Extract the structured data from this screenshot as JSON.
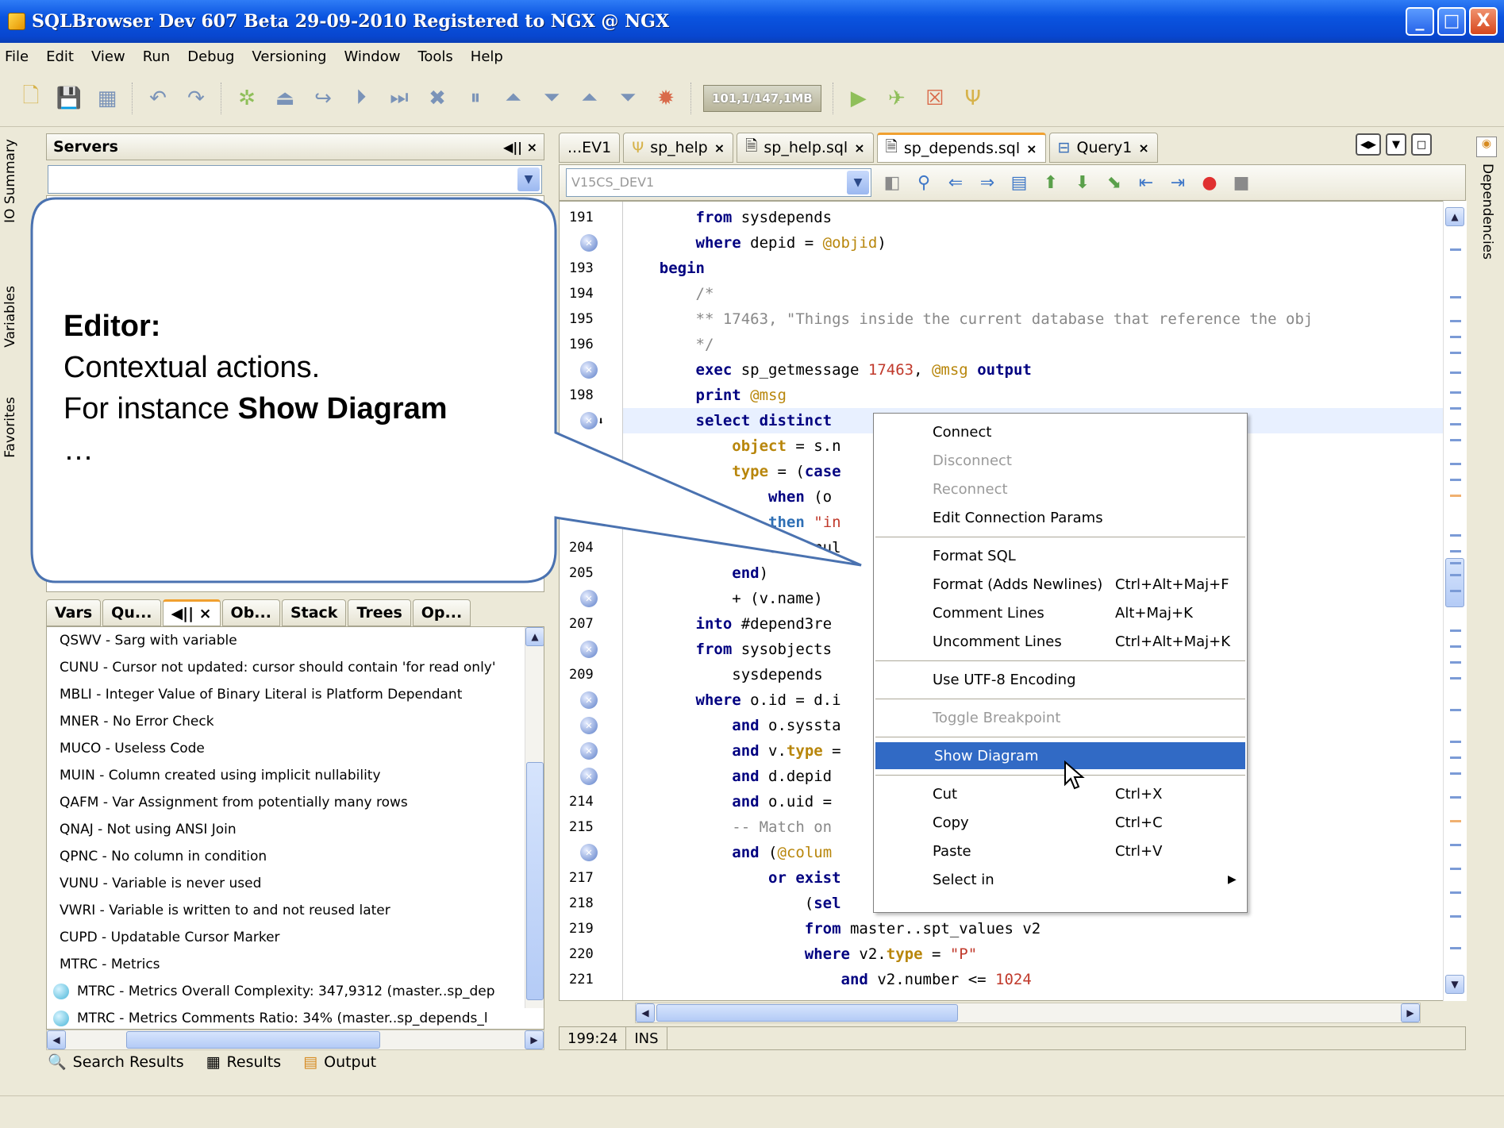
{
  "window": {
    "title": "SQLBrowser Dev 607 Beta  29-09-2010  Registered to NGX @ NGX",
    "minimize": "_",
    "maximize": "□",
    "close": "X"
  },
  "menu": [
    "File",
    "Edit",
    "View",
    "Run",
    "Debug",
    "Versioning",
    "Window",
    "Tools",
    "Help"
  ],
  "toolbar": {
    "memory": "101,1/147,1MB"
  },
  "left_side_tabs": [
    "IO Summary",
    "Variables",
    "Favorites"
  ],
  "servers_panel": {
    "title": "Servers",
    "controls": "◀|| ×"
  },
  "bottom_panel": {
    "tabs": [
      "Vars",
      "Qu...",
      "",
      "Ob...",
      "Stack",
      "Trees",
      "Op..."
    ],
    "active_controls": "◀|| ×",
    "rules": [
      "QSWV - Sarg with variable",
      "CUNU - Cursor not updated: cursor should contain 'for read only'",
      "MBLI - Integer Value of Binary Literal is Platform Dependant",
      "MNER - No Error Check",
      "MUCO - Useless Code",
      "MUIN - Column created using implicit nullability",
      "QAFM - Var Assignment from potentially many rows",
      "QNAJ - Not using ANSI Join",
      "QPNC - No column in condition",
      "VUNU - Variable is never used",
      "VWRI - Variable is written to and not reused later",
      "CUPD - Updatable Cursor Marker",
      "MTRC - Metrics"
    ],
    "metrics": [
      "MTRC - Metrics Overall Complexity: 347,9312 (master..sp_dep",
      "MTRC - Metrics Comments Ratio: 34% (master..sp_depends_l"
    ]
  },
  "bottom_status": [
    "Search Results",
    "Results",
    "Output"
  ],
  "editor": {
    "tabs": [
      {
        "label": "...EV1",
        "close": ""
      },
      {
        "label": "sp_help",
        "close": "×"
      },
      {
        "label": "sp_help.sql",
        "close": "×"
      },
      {
        "label": "sp_depends.sql",
        "close": "×"
      },
      {
        "label": "Query1",
        "close": "×"
      }
    ],
    "connection": "V15CS_DEV1",
    "cursor_pos": "199:24",
    "mode": "INS",
    "right_tab": "Dependencies"
  },
  "code_lines": [
    {
      "n": "191",
      "err": false,
      "html": "        <span class='kw'>from</span> sysdepends"
    },
    {
      "n": "",
      "err": true,
      "html": "        <span class='kw'>where</span> depid = <span class='var'>@objid</span>)"
    },
    {
      "n": "193",
      "err": false,
      "html": "    <span class='kw'>begin</span>"
    },
    {
      "n": "194",
      "err": false,
      "html": "        <span class='cm'>/*</span>"
    },
    {
      "n": "195",
      "err": false,
      "html": "        <span class='cm'>** 17463, \"Things inside the current database that reference the obj</span>"
    },
    {
      "n": "196",
      "err": false,
      "html": "        <span class='cm'>*/</span>"
    },
    {
      "n": "",
      "err": true,
      "html": "        <span class='kw'>exec</span> sp_getmessage <span class='num'>17463</span>, <span class='var'>@msg</span> <span class='kw'>output</span>"
    },
    {
      "n": "198",
      "err": false,
      "html": "        <span class='kw'>print</span> <span class='var'>@msg</span>"
    },
    {
      "n": "",
      "err": true,
      "html": "        <span class='kw'>select distinct</span>"
    },
    {
      "n": "",
      "err": false,
      "html": "            <span class='ty'>object</span> = s.n"
    },
    {
      "n": "",
      "err": false,
      "html": "            <span class='ty'>type</span> = (<span class='kw'>case</span>"
    },
    {
      "n": "",
      "err": false,
      "html": "                <span class='kw'>when</span> (o"
    },
    {
      "n": "",
      "err": false,
      "html": "                <span class='kw' style='color:#2e6fb5'>then</span> <span class='str'>\"in</span>"
    },
    {
      "n": "204",
      "err": false,
      "html": "                <span class='kw'>else</span> nul"
    },
    {
      "n": "205",
      "err": false,
      "html": "            <span class='kw'>end</span>)"
    },
    {
      "n": "",
      "err": true,
      "html": "            + (v.name)"
    },
    {
      "n": "207",
      "err": false,
      "html": "        <span class='kw'>into</span> #depend3re"
    },
    {
      "n": "",
      "err": true,
      "html": "        <span class='kw'>from</span> sysobjects"
    },
    {
      "n": "209",
      "err": false,
      "html": "            sysdepends"
    },
    {
      "n": "",
      "err": true,
      "html": "        <span class='kw'>where</span> o.id = d.i"
    },
    {
      "n": "",
      "err": true,
      "html": "            <span class='kw'>and</span> o.syssta"
    },
    {
      "n": "",
      "err": true,
      "html": "            <span class='kw'>and</span> v.<span class='ty'>type</span> ="
    },
    {
      "n": "",
      "err": true,
      "html": "            <span class='kw'>and</span> d.depid"
    },
    {
      "n": "214",
      "err": false,
      "html": "            <span class='kw'>and</span> o.uid ="
    },
    {
      "n": "215",
      "err": false,
      "html": "            <span class='cm'>-- Match on</span>"
    },
    {
      "n": "",
      "err": true,
      "html": "            <span class='kw'>and</span> (<span class='var'>@colum</span>"
    },
    {
      "n": "217",
      "err": false,
      "html": "                <span class='kw'>or exist</span>"
    },
    {
      "n": "218",
      "err": false,
      "html": "                    (<span class='kw'>sel</span>"
    },
    {
      "n": "219",
      "err": false,
      "html": "                    <span class='kw'>from</span> master..spt_values v2"
    },
    {
      "n": "220",
      "err": false,
      "html": "                    <span class='kw'>where</span> v2.<span class='ty'>type</span> = <span class='str'>\"P\"</span>"
    },
    {
      "n": "221",
      "err": false,
      "html": "                        <span class='kw'>and</span> v2.number &lt;= <span class='num'>1024</span>"
    }
  ],
  "context_menu": [
    {
      "label": "Connect",
      "shortcut": "",
      "disabled": false
    },
    {
      "label": "Disconnect",
      "shortcut": "",
      "disabled": true
    },
    {
      "label": "Reconnect",
      "shortcut": "",
      "disabled": true
    },
    {
      "label": "Edit Connection Params",
      "shortcut": "",
      "disabled": false
    },
    {
      "sep": true
    },
    {
      "label": "Format SQL",
      "shortcut": "",
      "disabled": false
    },
    {
      "label": "Format (Adds Newlines)",
      "shortcut": "Ctrl+Alt+Maj+F",
      "disabled": false
    },
    {
      "label": "Comment Lines",
      "shortcut": "Alt+Maj+K",
      "disabled": false
    },
    {
      "label": "Uncomment Lines",
      "shortcut": "Ctrl+Alt+Maj+K",
      "disabled": false
    },
    {
      "sep": true
    },
    {
      "label": "Use UTF-8 Encoding",
      "shortcut": "",
      "disabled": false
    },
    {
      "sep": true
    },
    {
      "label": "Toggle Breakpoint",
      "shortcut": "",
      "disabled": true
    },
    {
      "sep": true
    },
    {
      "label": "Show Diagram",
      "shortcut": "",
      "disabled": false,
      "selected": true
    },
    {
      "sep": true
    },
    {
      "label": "Cut",
      "shortcut": "Ctrl+X",
      "disabled": false
    },
    {
      "label": "Copy",
      "shortcut": "Ctrl+C",
      "disabled": false
    },
    {
      "label": "Paste",
      "shortcut": "Ctrl+V",
      "disabled": false
    },
    {
      "label": "Select in",
      "shortcut": "",
      "disabled": false,
      "submenu": true
    }
  ],
  "callout": {
    "heading": "Editor:",
    "line1": "Contextual actions.",
    "line2_prefix": "For instance ",
    "line2_bold": "Show Diagram",
    "line3": "…"
  }
}
